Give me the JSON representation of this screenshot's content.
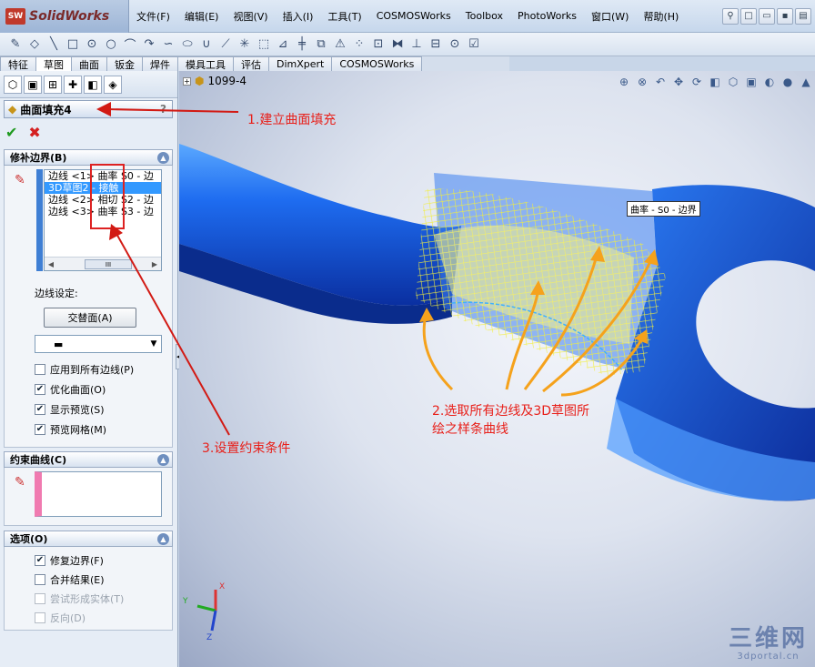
{
  "app": {
    "brand": "SolidWorks",
    "brand_badge": "SW"
  },
  "menu": [
    "文件(F)",
    "编辑(E)",
    "视图(V)",
    "插入(I)",
    "工具(T)",
    "COSMOSWorks",
    "Toolbox",
    "PhotoWorks",
    "窗口(W)",
    "帮助(H)"
  ],
  "tabs": [
    "特征",
    "草图",
    "曲面",
    "钣金",
    "焊件",
    "模具工具",
    "评估",
    "DimXpert",
    "COSMOSWorks"
  ],
  "active_tab": "草图",
  "feature_tree": {
    "root_label": "1099-4"
  },
  "property_manager": {
    "title": "曲面填充4",
    "help": "?",
    "ok": "✔",
    "cancel": "✖"
  },
  "patch_boundary": {
    "header": "修补边界(B)",
    "items": [
      {
        "label": "边线 <1>",
        "type": "曲率",
        "extra": "S0 - 边"
      },
      {
        "label": "3D草图2",
        "type": "接触",
        "extra": ""
      },
      {
        "label": "边线 <2>",
        "type": "相切",
        "extra": "S2 - 边"
      },
      {
        "label": "边线 <3>",
        "type": "曲率",
        "extra": "S3 - 边"
      }
    ],
    "selected_index": 1,
    "scroll_thumb": "III",
    "edge_settings_label": "边线设定:",
    "alternate_face_button": "交替面(A)",
    "apply_all_label": "应用到所有边线(P)",
    "apply_all_checked": false,
    "optimize_label": "优化曲面(O)",
    "optimize_checked": true,
    "show_preview_label": "显示预览(S)",
    "show_preview_checked": true,
    "preview_mesh_label": "预览网格(M)",
    "preview_mesh_checked": true
  },
  "constraint_curves": {
    "header": "约束曲线(C)"
  },
  "options": {
    "header": "选项(O)",
    "fix_boundary_label": "修复边界(F)",
    "fix_boundary_checked": true,
    "merge_result_label": "合并结果(E)",
    "merge_result_checked": false,
    "try_solid_label": "尝试形成实体(T)",
    "try_solid_checked": false,
    "reverse_label": "反向(D)",
    "reverse_checked": false
  },
  "viewport": {
    "tooltip": "曲率 - S0 - 边界",
    "triad": {
      "x": "X",
      "y": "Y",
      "z": "Z"
    },
    "watermark_big": "三维网",
    "watermark_small": "3dportal.cn"
  },
  "annotations": {
    "step1": "1.建立曲面填充",
    "step2_line1": "2.选取所有边线及3D草图所",
    "step2_line2": "绘之样条曲线",
    "step3": "3.设置约束条件"
  },
  "colors": {
    "annotation_red": "#e8201a",
    "arrow_orange": "#f5a21c",
    "part_blue": "#1a5ad8",
    "mesh_yellow": "#f2ee3c"
  }
}
